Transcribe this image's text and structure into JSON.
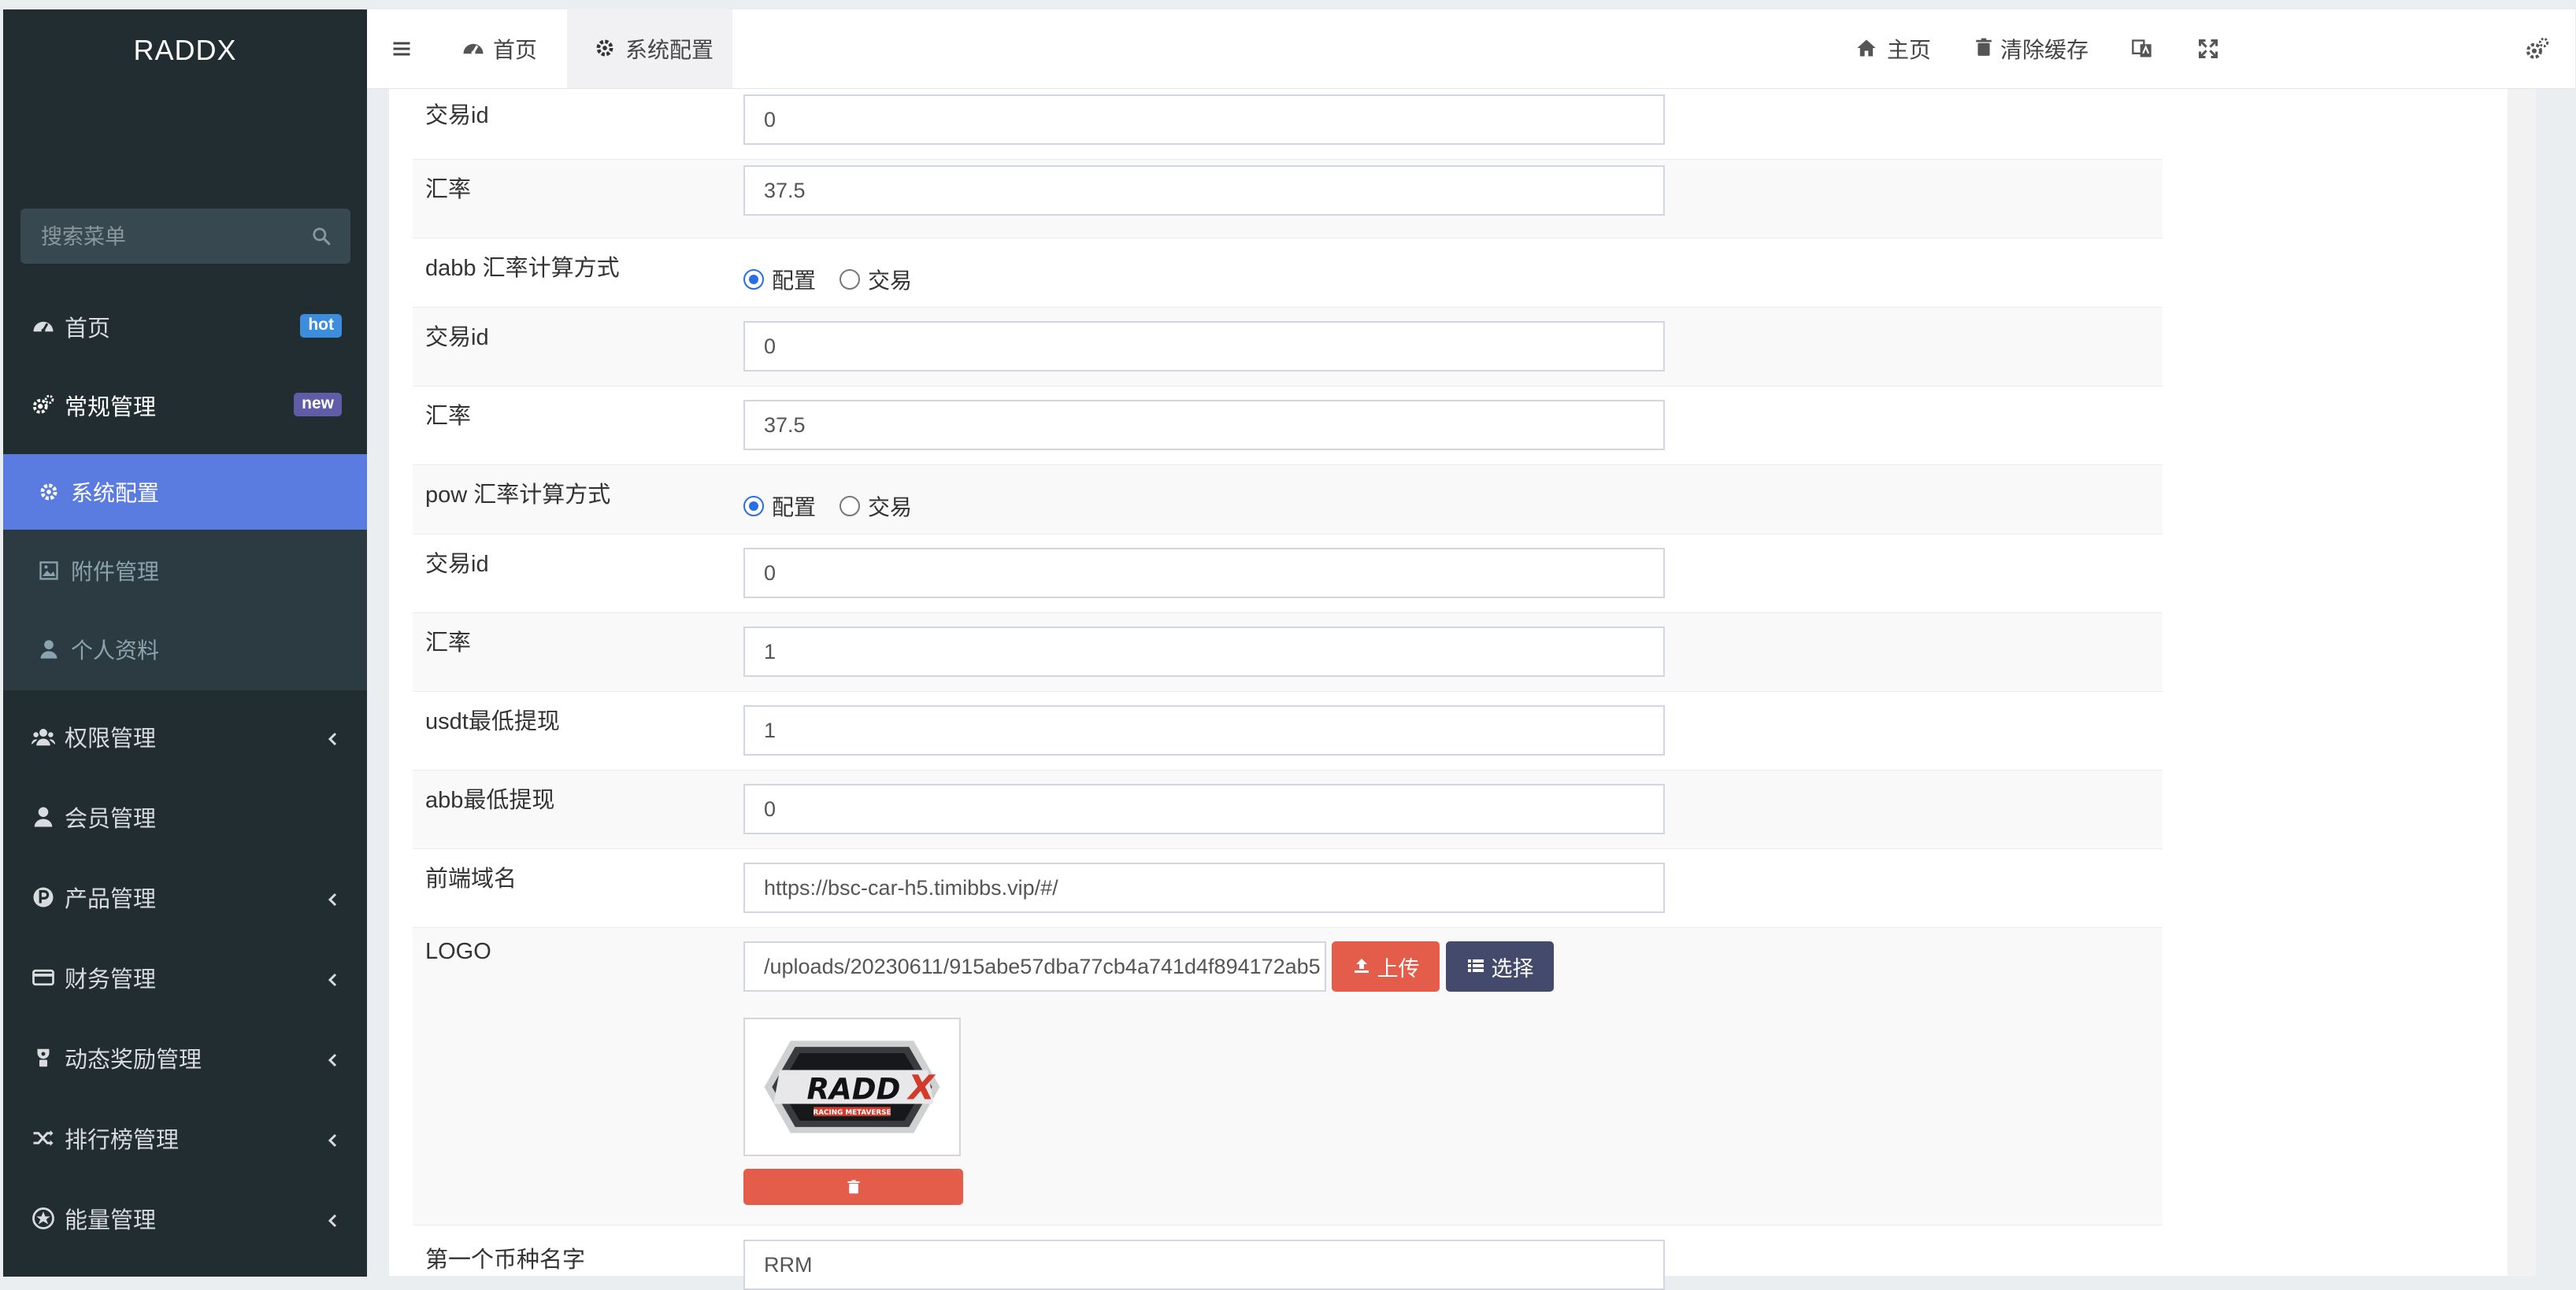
{
  "app": {
    "logo": "RADDX"
  },
  "colors": {
    "sidebar_bg": "#222d32",
    "active_blue": "#5a7be0",
    "badge_hot": "#3c8dde",
    "badge_new": "#605ca8",
    "upload_red": "#e35d4a",
    "select_navy": "#434a6b"
  },
  "sidebar": {
    "search_placeholder": "搜索菜单",
    "items": [
      {
        "label": "首页",
        "icon": "dashboard-icon",
        "badge": "hot"
      },
      {
        "label": "常规管理",
        "icon": "cogs-icon",
        "badge": "new"
      },
      {
        "label": "权限管理",
        "icon": "users-icon"
      },
      {
        "label": "会员管理",
        "icon": "user-icon"
      },
      {
        "label": "产品管理",
        "icon": "product-p-icon"
      },
      {
        "label": "财务管理",
        "icon": "credit-card-icon"
      },
      {
        "label": "动态奖励管理",
        "icon": "reward-icon"
      },
      {
        "label": "排行榜管理",
        "icon": "random-icon"
      },
      {
        "label": "能量管理",
        "icon": "energy-icon"
      }
    ],
    "subitems": [
      {
        "label": "系统配置",
        "icon": "gear-icon",
        "active": true
      },
      {
        "label": "附件管理",
        "icon": "image-icon"
      },
      {
        "label": "个人资料",
        "icon": "user-icon"
      }
    ]
  },
  "header": {
    "tabs": [
      {
        "label": "首页",
        "icon": "dashboard-icon"
      },
      {
        "label": "系统配置",
        "icon": "gear-icon"
      }
    ],
    "right": [
      {
        "label": "主页",
        "icon": "home-icon"
      },
      {
        "label": "清除缓存",
        "icon": "trash-icon"
      }
    ]
  },
  "form": {
    "rows": [
      {
        "label": "交易id",
        "value": "0"
      },
      {
        "label": "汇率",
        "value": "37.5"
      },
      {
        "label": "dabb 汇率计算方式",
        "options": [
          "配置",
          "交易"
        ],
        "selected": "配置"
      },
      {
        "label": "交易id",
        "value": "0"
      },
      {
        "label": "汇率",
        "value": "37.5"
      },
      {
        "label": "pow 汇率计算方式",
        "options": [
          "配置",
          "交易"
        ],
        "selected": "配置"
      },
      {
        "label": "交易id",
        "value": "0"
      },
      {
        "label": "汇率",
        "value": "1"
      },
      {
        "label": "usdt最低提现",
        "value": "1"
      },
      {
        "label": "abb最低提现",
        "value": "0"
      },
      {
        "label": "前端域名",
        "value": "https://bsc-car-h5.timibbs.vip/#/"
      },
      {
        "label": "LOGO",
        "value": "/uploads/20230611/915abe57dba77cb4a741d4f894172ab5",
        "upload_label": "上传",
        "select_label": "选择"
      },
      {
        "label": "第一个币种名字",
        "value": "RRM"
      }
    ],
    "logo_image": {
      "wordmark": "RADDX",
      "tagline": "RACING METAVERSE"
    }
  }
}
